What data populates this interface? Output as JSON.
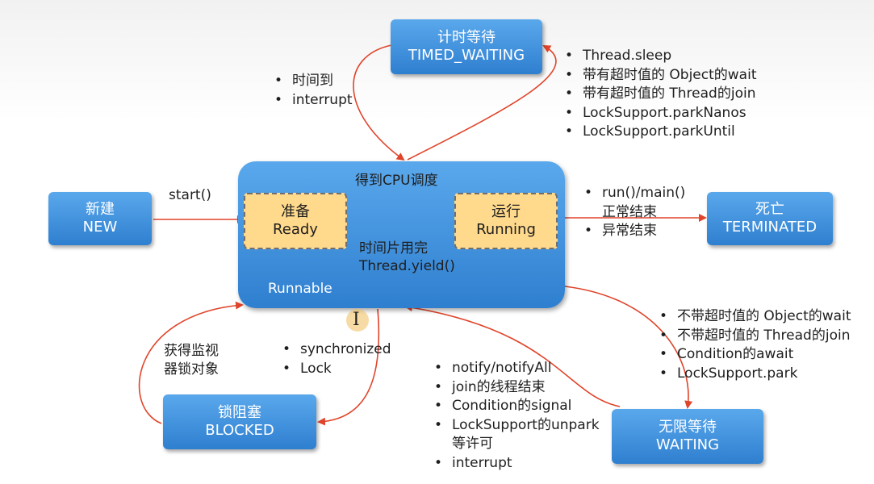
{
  "states": {
    "timed_waiting": {
      "cn": "计时等待",
      "en": "TIMED_WAITING"
    },
    "new": {
      "cn": "新建",
      "en": "NEW"
    },
    "terminated": {
      "cn": "死亡",
      "en": "TERMINATED"
    },
    "blocked": {
      "cn": "锁阻塞",
      "en": "BLOCKED"
    },
    "waiting": {
      "cn": "无限等待",
      "en": "WAITING"
    }
  },
  "runnable": {
    "label": "Runnable",
    "cpu_label": "得到CPU调度",
    "ready": {
      "cn": "准备",
      "en": "Ready"
    },
    "running": {
      "cn": "运行",
      "en": "Running"
    },
    "yield_line1": "时间片用完",
    "yield_line2": "Thread.yield()"
  },
  "labels": {
    "start": "start()",
    "acquire_line1": "获得监视",
    "acquire_line2": "器锁对象"
  },
  "lists": {
    "timeout_return": [
      "时间到",
      "interrupt"
    ],
    "to_timed_waiting": [
      "Thread.sleep",
      "带有超时值的 Object的wait",
      "带有超时值的 Thread的join",
      "LockSupport.parkNanos",
      "LockSupport.parkUntil"
    ],
    "terminate": [
      {
        "line1": "run()/main()",
        "line2": "正常结束"
      },
      {
        "line1": "异常结束",
        "line2": ""
      }
    ],
    "to_blocked": [
      "synchronized",
      "Lock"
    ],
    "to_waiting": [
      "不带超时值的 Object的wait",
      "不带超时值的 Thread的join",
      "Condition的await",
      "LockSupport.park"
    ],
    "wake_up": [
      {
        "line1": "notify/notifyAll",
        "line2": ""
      },
      {
        "line1": "join的线程结束",
        "line2": ""
      },
      {
        "line1": "Condition的signal",
        "line2": ""
      },
      {
        "line1": "LockSupport的unpark",
        "line2": "等许可"
      },
      {
        "line1": "interrupt",
        "line2": ""
      }
    ]
  },
  "colors": {
    "state_fill": "#3a8ede",
    "inner_fill": "#ffd98c",
    "arrow_red": "#e0442a",
    "arrow_orange": "#e8a21c"
  }
}
